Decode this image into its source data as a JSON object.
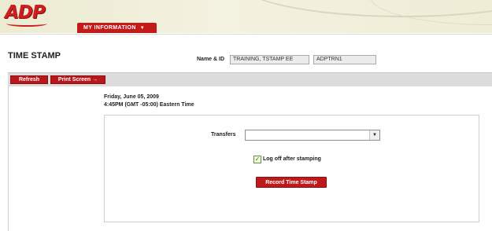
{
  "brand": {
    "logo_text": "ADP",
    "accent_color": "#c41a1a"
  },
  "nav": {
    "tab_label": "MY INFORMATION",
    "tab_icon": "caret-down-icon"
  },
  "page": {
    "title": "TIME STAMP"
  },
  "identity": {
    "label": "Name & ID",
    "name_value": "TRAINING, TSTAMP EE",
    "id_value": "ADPTRN1"
  },
  "toolbar": {
    "refresh_label": "Refresh",
    "print_label": "Print Screen →"
  },
  "datetime": {
    "date": "Friday, June 05, 2009",
    "time": "4:45PM (GMT -05:00) Eastern Time"
  },
  "form": {
    "transfers_label": "Transfers",
    "transfers_value": "",
    "logoff_label": "Log off after stamping",
    "logoff_checked": true,
    "record_button_label": "Record Time Stamp"
  }
}
